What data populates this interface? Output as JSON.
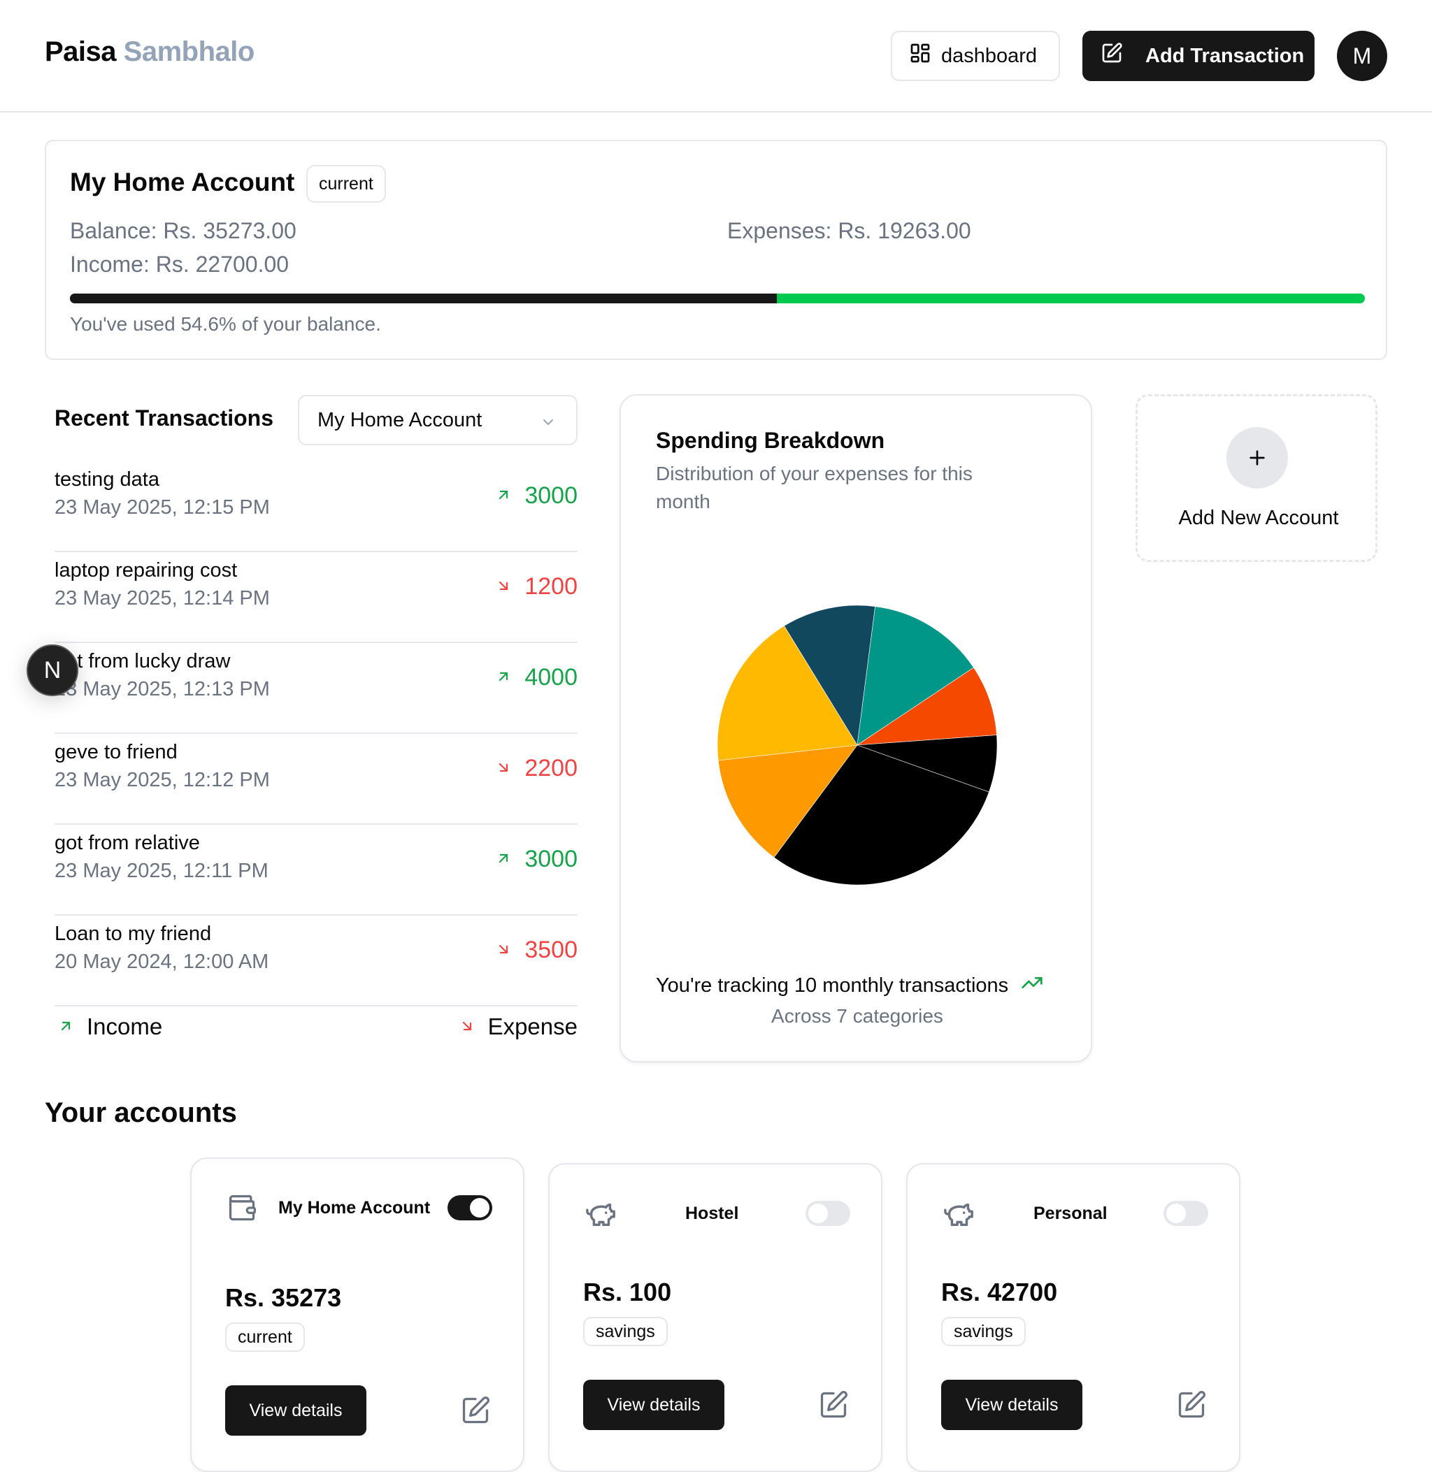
{
  "header": {
    "brand_part1": "Paisa",
    "brand_part2": "Sambhalo",
    "dashboard_label": "dashboard",
    "add_transaction_label": "Add Transaction",
    "avatar_initial": "M"
  },
  "current_account": {
    "name": "My Home Account",
    "badge": "current",
    "balance": "Balance: Rs. 35273.00",
    "income": "Income: Rs. 22700.00",
    "expenses": "Expenses: Rs. 19263.00",
    "used_fraction": 0.546,
    "used_text": "You've used 54.6% of your balance.",
    "colors": {
      "used": "#171717",
      "remaining": "#00c950"
    }
  },
  "recent": {
    "title": "Recent Transactions",
    "selected_account": "My Home Account",
    "transactions": [
      {
        "name": "testing data",
        "date": "23 May 2025, 12:15 PM",
        "amount": "3000",
        "type": "income"
      },
      {
        "name": "laptop repairing cost",
        "date": "23 May 2025, 12:14 PM",
        "amount": "1200",
        "type": "expense"
      },
      {
        "name": "got from lucky draw",
        "date": "23 May 2025, 12:13 PM",
        "amount": "4000",
        "type": "income"
      },
      {
        "name": "geve to friend",
        "date": "23 May 2025, 12:12 PM",
        "amount": "2200",
        "type": "expense"
      },
      {
        "name": "got from relative",
        "date": "23 May 2025, 12:11 PM",
        "amount": "3000",
        "type": "income"
      },
      {
        "name": "Loan to my friend",
        "date": "20 May 2024, 12:00 AM",
        "amount": "3500",
        "type": "expense"
      }
    ],
    "legend_income": "Income",
    "legend_expense": "Expense",
    "colors": {
      "income": "#16a34a",
      "expense": "#ef4444"
    }
  },
  "dev_badge": "N",
  "spending": {
    "title": "Spending Breakdown",
    "subtitle": "Distribution of your expenses for this month",
    "tracking_text": "You're tracking 10 monthly transactions",
    "categories_text": "Across 7 categories"
  },
  "chart_data": {
    "type": "pie",
    "slices": [
      {
        "value": 10.8,
        "color": "#12485e"
      },
      {
        "value": 13.6,
        "color": "#009688"
      },
      {
        "value": 8.2,
        "color": "#f54900"
      },
      {
        "value": 6.6,
        "color": "#000000"
      },
      {
        "value": 29.7,
        "color": "#000000"
      },
      {
        "value": 13.1,
        "color": "#fe9a00"
      },
      {
        "value": 18.0,
        "color": "#ffb900"
      }
    ]
  },
  "add_account": {
    "label": "Add New Account"
  },
  "accounts_section": {
    "title": "Your accounts",
    "accounts": [
      {
        "name": "My Home Account",
        "balance": "Rs. 35273",
        "type": "current",
        "active": true,
        "icon": "wallet-icon",
        "view_label": "View details"
      },
      {
        "name": "Hostel",
        "balance": "Rs. 100",
        "type": "savings",
        "active": false,
        "icon": "piggy-bank-icon",
        "view_label": "View details"
      },
      {
        "name": "Personal",
        "balance": "Rs. 42700",
        "type": "savings",
        "active": false,
        "icon": "piggy-bank-icon",
        "view_label": "View details"
      }
    ]
  }
}
